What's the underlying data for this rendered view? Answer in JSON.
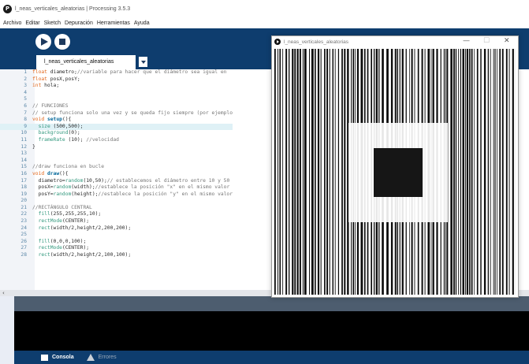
{
  "ide": {
    "window_title": "l_neas_verticales_aleatorias | Processing 3.5.3",
    "menu": [
      "Archivo",
      "Editar",
      "Sketch",
      "Depuración",
      "Herramientas",
      "Ayuda"
    ],
    "tab_label": "l_neas_verticales_aleatorias",
    "status_bottom": {
      "console": "Consola",
      "errors": "Errores"
    }
  },
  "code": [
    {
      "n": "1",
      "t": "float diametro;//variable para hacer que el diámetro sea igual en "
    },
    {
      "n": "2",
      "t": "float posX,posY;"
    },
    {
      "n": "3",
      "t": "int hola;"
    },
    {
      "n": "4",
      "t": ""
    },
    {
      "n": "5",
      "t": ""
    },
    {
      "n": "6",
      "t": "// FUNCIONES"
    },
    {
      "n": "7",
      "t": "// setup funciona solo una vez y se queda fijo siempre (por ejemplo"
    },
    {
      "n": "8",
      "t": "void setup(){"
    },
    {
      "n": "9",
      "t": "  size (500,500);"
    },
    {
      "n": "10",
      "t": "  background(0);"
    },
    {
      "n": "11",
      "t": "  frameRate (10); //velocidad"
    },
    {
      "n": "12",
      "t": "}"
    },
    {
      "n": "13",
      "t": ""
    },
    {
      "n": "14",
      "t": ""
    },
    {
      "n": "15",
      "t": "//draw funciona en bucle"
    },
    {
      "n": "16",
      "t": "void draw(){"
    },
    {
      "n": "17",
      "t": "  diametro=random(10,50);// establecemos el diámetro entre 10 y 50"
    },
    {
      "n": "18",
      "t": "  posX=random(width);//establece la posición \"x\" en el mismo valor"
    },
    {
      "n": "19",
      "t": "  posY=random(height);//establece la posición \"y\" en el mismo valor"
    },
    {
      "n": "20",
      "t": ""
    },
    {
      "n": "21",
      "t": "//RECTÁNGULO CENTRAL"
    },
    {
      "n": "22",
      "t": "  fill(255,255,255,10);"
    },
    {
      "n": "23",
      "t": "  rectMode(CENTER);"
    },
    {
      "n": "24",
      "t": "  rect(width/2,height/2,200,200);"
    },
    {
      "n": "25",
      "t": ""
    },
    {
      "n": "26",
      "t": "  fill(0,0,0,100);"
    },
    {
      "n": "27",
      "t": "  rectMode(CENTER);"
    },
    {
      "n": "28",
      "t": "  rect(width/2,height/2,100,100);"
    }
  ],
  "highlighted_line": "9",
  "sketch_window": {
    "title": "l_neas_verticales_aleatorias",
    "controls": {
      "minimize": "—",
      "maximize": "☐",
      "close": "✕"
    }
  },
  "colors": {
    "toolbar": "#0e3d6e",
    "keyword": "#e2661a",
    "function": "#006699",
    "comment": "#777777",
    "line_number": "#5b87a7"
  }
}
